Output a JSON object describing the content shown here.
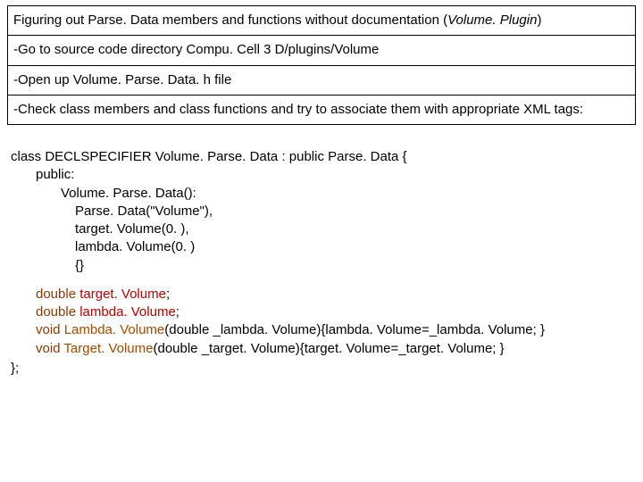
{
  "title_prefix": "Figuring out Parse. Data members and functions without documentation (",
  "title_italic": "Volume. Plugin",
  "title_suffix": ")",
  "row1": "-Go to source code directory Compu. Cell 3 D/plugins/Volume",
  "row2": "-Open up Volume. Parse. Data. h file",
  "row3": "-Check class members and class functions and try to associate them with appropriate XML tags:",
  "code": {
    "l1": "class DECLSPECIFIER Volume. Parse. Data : public Parse. Data {",
    "l2": "public:",
    "l3": "Volume. Parse. Data():",
    "l4": "Parse. Data(\"Volume\"),",
    "l5": "target. Volume(0. ),",
    "l6": "lambda. Volume(0. )",
    "l7": "{}",
    "m1_a": "double ",
    "m1_b": "target. Volume",
    "m1_c": ";",
    "m2_a": "double ",
    "m2_b": "lambda. Volume",
    "m2_c": ";",
    "m3_a": "void ",
    "m3_b": "Lambda. Volume",
    "m3_c": "(double _lambda. Volume){lambda. Volume=_lambda. Volume; }",
    "m4_a": "void ",
    "m4_b": "Target. Volume",
    "m4_c": "(double _target. Volume){target. Volume=_target. Volume; }",
    "end": "};"
  }
}
